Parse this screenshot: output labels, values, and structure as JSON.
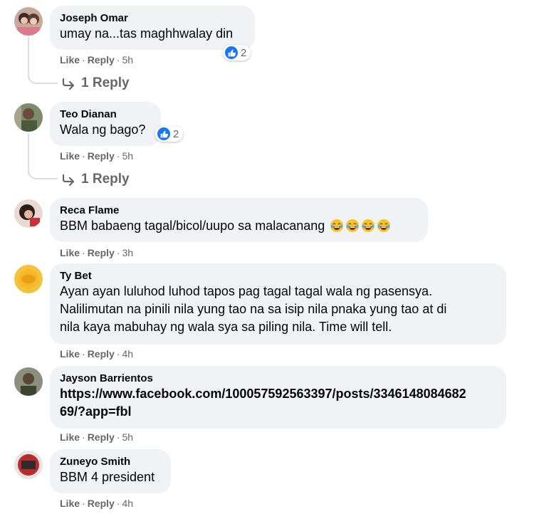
{
  "comments": [
    {
      "name": "Joseph Omar",
      "text": "umay na...tas maghhwalay din",
      "reactions": "2",
      "actions": {
        "like": "Like",
        "reply": "Reply",
        "time": "5h"
      },
      "replies_label": "1 Reply"
    },
    {
      "name": "Teo Dianan",
      "text": "Wala ng bago?",
      "reactions": "2",
      "actions": {
        "like": "Like",
        "reply": "Reply",
        "time": "5h"
      },
      "replies_label": "1 Reply"
    },
    {
      "name": "Reca Flame",
      "text": "BBM babaeng tagal/bicol/uupo sa malacanang",
      "emoji_count": 4,
      "actions": {
        "like": "Like",
        "reply": "Reply",
        "time": "3h"
      }
    },
    {
      "name": "Ty Bet",
      "text_lines": [
        "Ayan ayan luluhod luhod tapos pag tagal tagal wala ng pasensya.",
        "Nalilimutan na pinili nila yung tao na sa isip nila pnaka yung tao at di",
        "nila kaya mabuhay ng wala sya sa piling nila. Time will tell."
      ],
      "actions": {
        "like": "Like",
        "reply": "Reply",
        "time": "4h"
      }
    },
    {
      "name": "Jayson Barrientos",
      "text_lines": [
        "https://www.facebook.com/100057592563397/posts/3346148084682",
        "69/?app=fbl"
      ],
      "actions": {
        "like": "Like",
        "reply": "Reply",
        "time": "5h"
      }
    },
    {
      "name": "Zuneyo Smith",
      "text": "BBM 4 president",
      "actions": {
        "like": "Like",
        "reply": "Reply",
        "time": "4h"
      }
    }
  ],
  "colors": {
    "bubble": "#f0f2f5",
    "meta_text": "#65676b",
    "like_blue": "#1877f2",
    "thread_line": "#dadde1"
  }
}
